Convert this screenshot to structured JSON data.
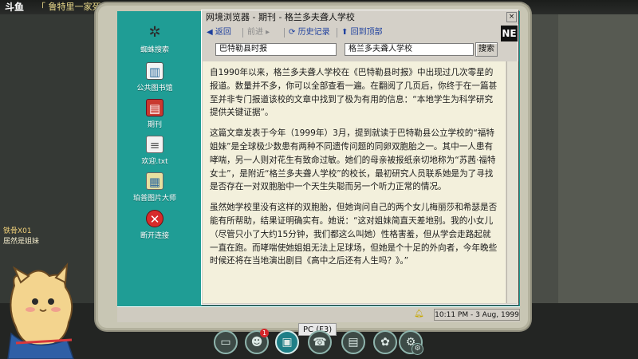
{
  "stream": {
    "logo": "斗鱼",
    "title": "「 鲁特里一家死了 · 狂热 」- Steam"
  },
  "desktop": {
    "icons": [
      {
        "label": "蜘蛛搜索",
        "icon": "spider-icon"
      },
      {
        "label": "公共图书馆",
        "icon": "library-icon"
      },
      {
        "label": "期刊",
        "icon": "journal-icon"
      },
      {
        "label": "欢迎.txt",
        "icon": "text-file-icon"
      },
      {
        "label": "珀普图片大师",
        "icon": "image-editor-icon"
      },
      {
        "label": "断开连接",
        "icon": "disconnect-icon"
      }
    ]
  },
  "browser": {
    "title": "网境浏览器 - 期刊 - 格兰多夫聋人学校",
    "close_label": "×",
    "toolbar": {
      "back": "◀ 返回",
      "forward": "前进 ▸",
      "history": "历史记录",
      "top": "回到顶部"
    },
    "badge": "NE",
    "source_field": "巴特勒县时报",
    "query_field": "格兰多夫聋人学校",
    "search_button": "搜索",
    "paragraphs": [
      "自1990年以来，格兰多夫聋人学校在《巴特勒县时报》中出现过几次零星的报道。数量并不多，你可以全部查看一遍。在翻阅了几页后，你终于在一篇甚至并非专门报道该校的文章中找到了极为有用的信息：“本地学生为科学研究提供关键证据”。",
      "这篇文章发表于今年（1999年）3月，提到就读于巴特勒县公立学校的“福特姐妹”是全球极少数患有两种不同遗传问题的同卵双胞胎之一。其中一人患有哮喘，另一人则对花生有致命过敏。她们的母亲被报纸亲切地称为“苏茜·福特女士”，是附近“格兰多夫聋人学校”的校长，最初研究人员联系她是为了寻找是否存在一对双胞胎中一个天生失聪而另一个听力正常的情况。",
      "虽然她学校里没有这样的双胞胎，但她询问自己的两个女儿梅丽莎和希瑟是否能有所帮助，结果证明确实有。她说：“这对姐妹简直天差地别。我的小女儿（尽管只小了大约15分钟，我们都这么叫她）性格害羞，但从学会走路起就一直在跑。而哮喘使她姐姐无法上足球场，但她是个十足的外向者，今年晚些时候还将在当地演出剧目《高中之后还有人生吗？》。”"
    ]
  },
  "taskbar": {
    "clock": "10:11 PM - 3 Aug, 1999"
  },
  "game_toolbar": {
    "tooltip": "PC (F3)",
    "notification_count": "1",
    "buttons": [
      "map-icon",
      "contacts-icon",
      "pc-icon",
      "phone-icon",
      "notes-icon",
      "brain-icon",
      "settings-icon"
    ]
  },
  "chat": {
    "user": "铁骨X01",
    "message": "居然是姐妹"
  },
  "colors": {
    "desktop_bg": "#1f9d95",
    "window_bg": "#d4d0c8",
    "content_bg": "#f3f0dc",
    "link_blue": "#1d3f9e"
  }
}
